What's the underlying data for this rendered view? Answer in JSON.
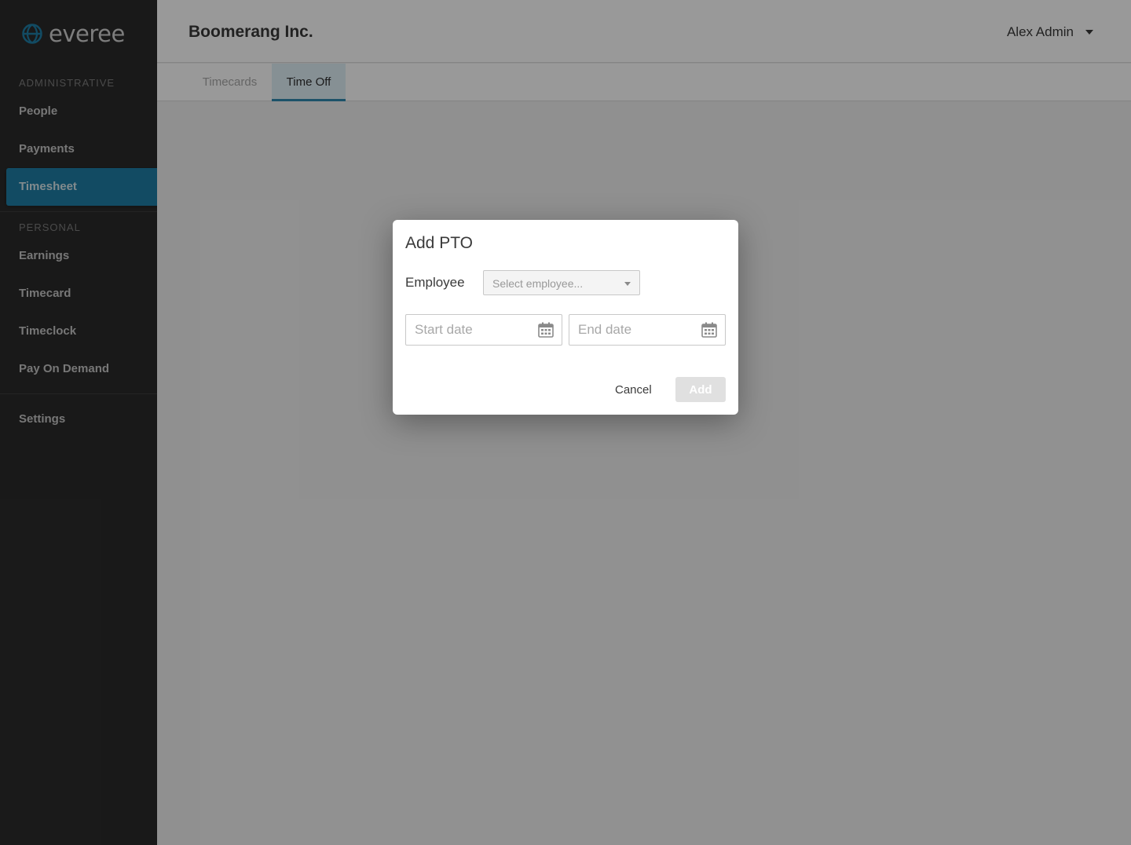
{
  "app": {
    "logo_text": "everee"
  },
  "sidebar": {
    "admin_section": "ADMINISTRATIVE",
    "admin_items": [
      {
        "label": "People"
      },
      {
        "label": "Payments"
      },
      {
        "label": "Timesheet"
      }
    ],
    "active_item": "Timesheet",
    "personal_section": "PERSONAL",
    "personal_items": [
      {
        "label": "Earnings"
      },
      {
        "label": "Timecard"
      },
      {
        "label": "Timeclock"
      },
      {
        "label": "Pay On Demand"
      }
    ],
    "settings_label": "Settings"
  },
  "header": {
    "company": "Boomerang Inc.",
    "user": "Alex Admin"
  },
  "tabs": [
    {
      "label": "Timecards",
      "active": false
    },
    {
      "label": "Time Off",
      "active": true
    }
  ],
  "modal": {
    "title": "Add PTO",
    "employee_label": "Employee",
    "employee_placeholder": "Select employee...",
    "start_placeholder": "Start date",
    "end_placeholder": "End date",
    "cancel_label": "Cancel",
    "add_label": "Add"
  },
  "colors": {
    "sidebar_bg": "#2b2b2b",
    "accent": "#1e7ea5",
    "logo_globe": "#1e7ea5"
  }
}
